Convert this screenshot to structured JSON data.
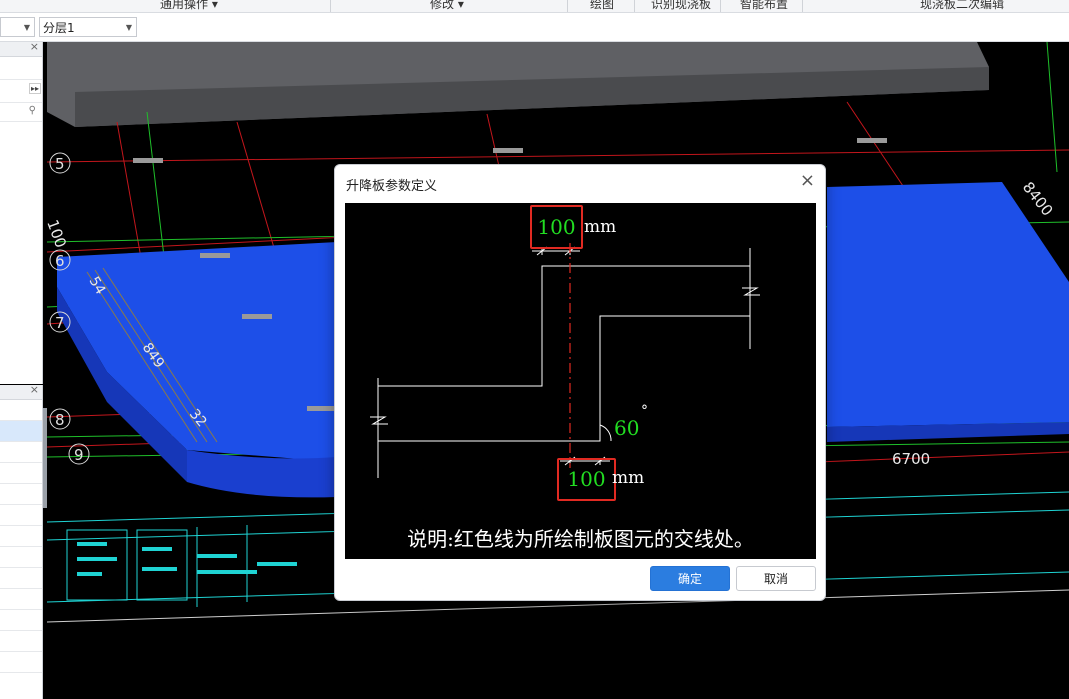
{
  "ribbon": {
    "groups": [
      "通用操作",
      "修改",
      "绘图",
      "识别现浇板",
      "智能布置",
      "现浇板二次编辑"
    ]
  },
  "toolbar2": {
    "layer_value": "分层1"
  },
  "viewport": {
    "axis_labels": [
      "5",
      "6",
      "7",
      "8",
      "9"
    ],
    "dims": {
      "d8400": "8400",
      "d6700": "6700",
      "d100": "100",
      "d54": "54",
      "d849": "849",
      "d32": "32"
    }
  },
  "dialog": {
    "title": "升降板参数定义",
    "top_value": "100",
    "bottom_value": "100",
    "unit_top": "mm",
    "unit_bottom": "mm",
    "angle_value": "60",
    "degree_symbol": "°",
    "note": "说明:红色线为所绘制板图元的交线处。",
    "ok_label": "确定",
    "cancel_label": "取消"
  },
  "colors": {
    "accent": "#2b7de0",
    "highlight_box": "#e12a22",
    "value_green": "#22dd22",
    "slab_blue": "#1d4fe8"
  }
}
